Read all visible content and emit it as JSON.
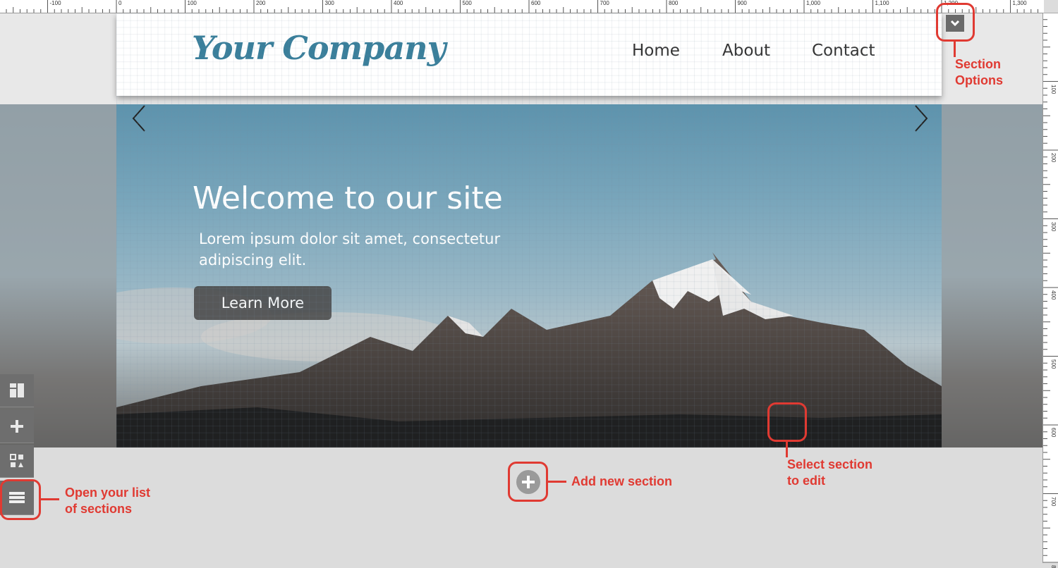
{
  "ruler": {
    "horizontal_labels": [
      "-100",
      "0",
      "100",
      "200",
      "300",
      "400",
      "500",
      "600",
      "700",
      "800",
      "900",
      "1,000",
      "1,100",
      "1,200",
      "1,300"
    ],
    "vertical_labels": [
      "100",
      "200",
      "300",
      "400",
      "500",
      "600",
      "700",
      "8"
    ]
  },
  "site": {
    "logo": "Your Company",
    "nav": [
      "Home",
      "About",
      "Contact"
    ]
  },
  "hero": {
    "title": "Welcome to our site",
    "text": "Lorem ipsum dolor sit amet, consectetur adipiscing elit.",
    "button": "Learn More"
  },
  "annotations": {
    "section_options": "Section\nOptions",
    "select_section": "Select section\nto edit",
    "add_section": "Add new section",
    "open_list": "Open your list\nof sections"
  },
  "colors": {
    "logo": "#3a7f9b",
    "annotation": "#e03a32",
    "tool_bg": "#6e6e6e"
  },
  "icons": [
    "layout-icon",
    "plus-icon",
    "widgets-icon",
    "list-icon",
    "chevron-down-icon",
    "chevron-left-icon",
    "chevron-right-icon",
    "add-circle-icon"
  ]
}
